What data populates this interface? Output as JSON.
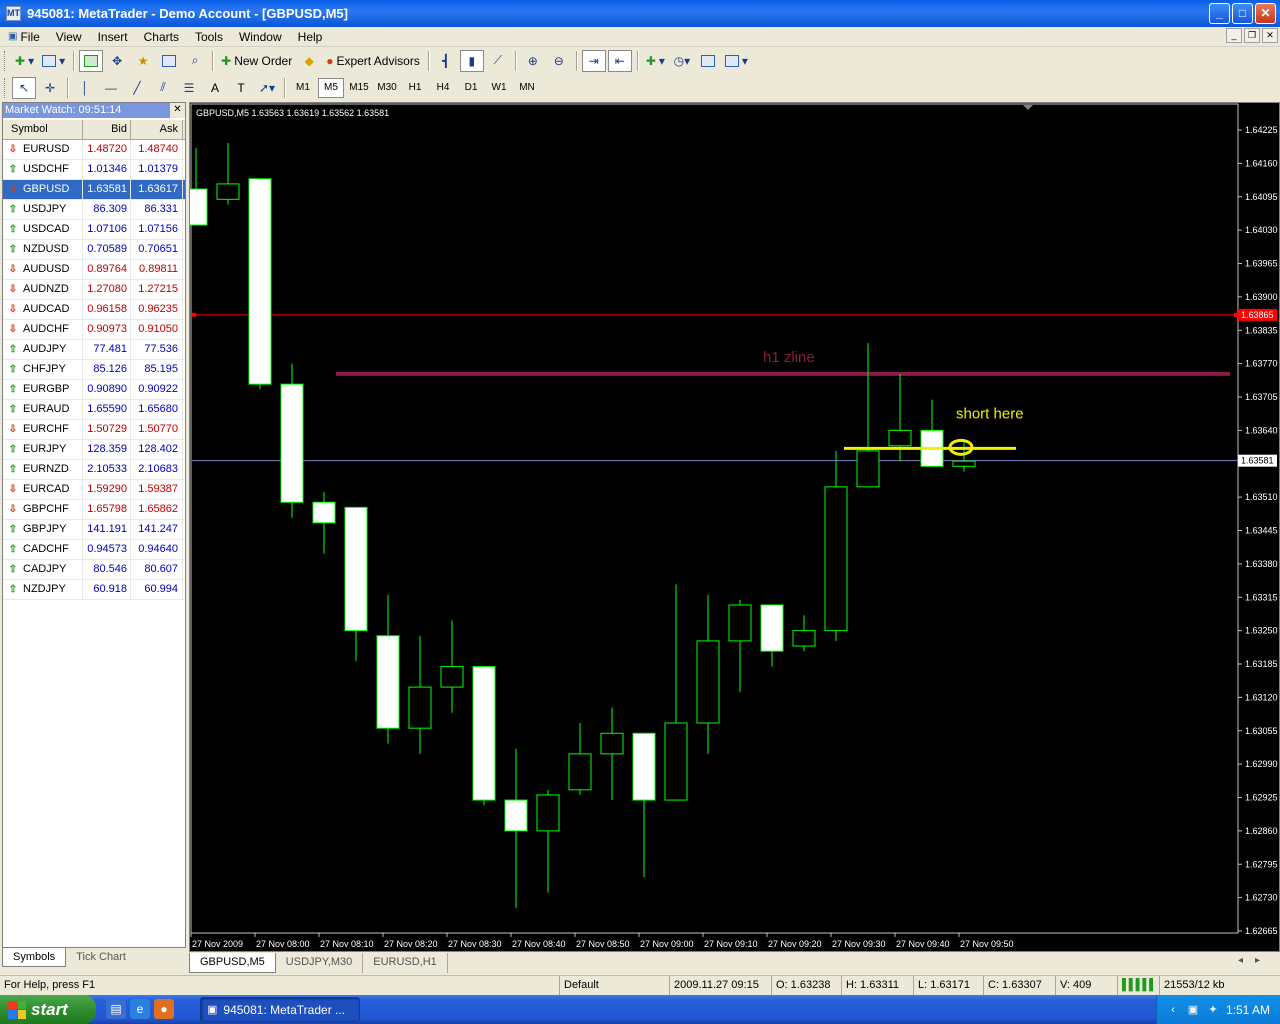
{
  "window": {
    "title": "945081: MetaTrader - Demo Account - [GBPUSD,M5]",
    "app_icon_label": "MT"
  },
  "menu": [
    "File",
    "View",
    "Insert",
    "Charts",
    "Tools",
    "Window",
    "Help"
  ],
  "toolbar": {
    "new_order": "New Order",
    "expert_advisors": "Expert Advisors",
    "draw_text": "A",
    "draw_label": "T"
  },
  "timeframes": [
    "M1",
    "M5",
    "M15",
    "M30",
    "H1",
    "H4",
    "D1",
    "W1",
    "MN"
  ],
  "active_timeframe": "M5",
  "market_watch": {
    "title": "Market Watch: 09:51:14",
    "columns": [
      "Symbol",
      "Bid",
      "Ask"
    ],
    "rows": [
      {
        "symbol": "EURUSD",
        "bid": "1.48720",
        "ask": "1.48740",
        "dir": "down",
        "color": "#c00000"
      },
      {
        "symbol": "USDCHF",
        "bid": "1.01346",
        "ask": "1.01379",
        "dir": "up",
        "color": "#0000c0"
      },
      {
        "symbol": "GBPUSD",
        "bid": "1.63581",
        "ask": "1.63617",
        "dir": "down",
        "color": "#ffffff"
      },
      {
        "symbol": "USDJPY",
        "bid": "86.309",
        "ask": "86.331",
        "dir": "up",
        "color": "#0000c0"
      },
      {
        "symbol": "USDCAD",
        "bid": "1.07106",
        "ask": "1.07156",
        "dir": "up",
        "color": "#0000c0"
      },
      {
        "symbol": "NZDUSD",
        "bid": "0.70589",
        "ask": "0.70651",
        "dir": "up",
        "color": "#0000c0"
      },
      {
        "symbol": "AUDUSD",
        "bid": "0.89764",
        "ask": "0.89811",
        "dir": "down",
        "color": "#c00000"
      },
      {
        "symbol": "AUDNZD",
        "bid": "1.27080",
        "ask": "1.27215",
        "dir": "down",
        "color": "#c00000"
      },
      {
        "symbol": "AUDCAD",
        "bid": "0.96158",
        "ask": "0.96235",
        "dir": "down",
        "color": "#c00000"
      },
      {
        "symbol": "AUDCHF",
        "bid": "0.90973",
        "ask": "0.91050",
        "dir": "down",
        "color": "#c00000"
      },
      {
        "symbol": "AUDJPY",
        "bid": "77.481",
        "ask": "77.536",
        "dir": "up",
        "color": "#0000c0"
      },
      {
        "symbol": "CHFJPY",
        "bid": "85.126",
        "ask": "85.195",
        "dir": "up",
        "color": "#0000c0"
      },
      {
        "symbol": "EURGBP",
        "bid": "0.90890",
        "ask": "0.90922",
        "dir": "up",
        "color": "#0000c0"
      },
      {
        "symbol": "EURAUD",
        "bid": "1.65590",
        "ask": "1.65680",
        "dir": "up",
        "color": "#0000c0"
      },
      {
        "symbol": "EURCHF",
        "bid": "1.50729",
        "ask": "1.50770",
        "dir": "down",
        "color": "#c00000"
      },
      {
        "symbol": "EURJPY",
        "bid": "128.359",
        "ask": "128.402",
        "dir": "up",
        "color": "#0000c0"
      },
      {
        "symbol": "EURNZD",
        "bid": "2.10533",
        "ask": "2.10683",
        "dir": "up",
        "color": "#0000c0"
      },
      {
        "symbol": "EURCAD",
        "bid": "1.59290",
        "ask": "1.59387",
        "dir": "down",
        "color": "#c00000"
      },
      {
        "symbol": "GBPCHF",
        "bid": "1.65798",
        "ask": "1.65862",
        "dir": "down",
        "color": "#c00000"
      },
      {
        "symbol": "GBPJPY",
        "bid": "141.191",
        "ask": "141.247",
        "dir": "up",
        "color": "#0000c0"
      },
      {
        "symbol": "CADCHF",
        "bid": "0.94573",
        "ask": "0.94640",
        "dir": "up",
        "color": "#0000c0"
      },
      {
        "symbol": "CADJPY",
        "bid": "80.546",
        "ask": "80.607",
        "dir": "up",
        "color": "#0000c0"
      },
      {
        "symbol": "NZDJPY",
        "bid": "60.918",
        "ask": "60.994",
        "dir": "up",
        "color": "#0000c0"
      }
    ],
    "tabs": [
      "Symbols",
      "Tick Chart"
    ]
  },
  "chart": {
    "info": "GBPUSD,M5  1.63563 1.63619 1.63562 1.63581",
    "price_labels": [
      "1.64225",
      "1.64160",
      "1.64095",
      "1.64030",
      "1.63965",
      "1.63900",
      "1.63835",
      "1.63770",
      "1.63705",
      "1.63640",
      "1.63510",
      "1.63445",
      "1.63380",
      "1.63315",
      "1.63250",
      "1.63185",
      "1.63120",
      "1.63055",
      "1.62990",
      "1.62925",
      "1.62860",
      "1.62795",
      "1.62730",
      "1.62665"
    ],
    "time_labels": [
      "27 Nov 2009",
      "27 Nov 08:00",
      "27 Nov 08:10",
      "27 Nov 08:20",
      "27 Nov 08:30",
      "27 Nov 08:40",
      "27 Nov 08:50",
      "27 Nov 09:00",
      "27 Nov 09:10",
      "27 Nov 09:20",
      "27 Nov 09:30",
      "27 Nov 09:40",
      "27 Nov 09:50"
    ],
    "current_price_label": "1.63581",
    "red_line_label": "1.63865",
    "annotation_zline": "h1 zline",
    "annotation_short": "short here",
    "colors": {
      "bg": "#000000",
      "bull": "#00ff00",
      "bear_body": "#ffffff",
      "zline": "#8b1c4a",
      "yellow": "#f0f000",
      "red": "#ff0000",
      "bid": "#8080c0"
    }
  },
  "chart_data": {
    "type": "candlestick",
    "title": "GBPUSD,M5",
    "ylim": [
      1.6263,
      1.6426
    ],
    "series": [
      {
        "name": "GBPUSD",
        "ohlc": [
          [
            1.6411,
            1.6419,
            1.6404,
            1.6404
          ],
          [
            1.6409,
            1.642,
            1.6408,
            1.6412
          ],
          [
            1.6413,
            1.6413,
            1.6372,
            1.6373
          ],
          [
            1.6373,
            1.6377,
            1.6347,
            1.635
          ],
          [
            1.635,
            1.6352,
            1.634,
            1.6346
          ],
          [
            1.6349,
            1.6349,
            1.6319,
            1.6325
          ],
          [
            1.6324,
            1.6332,
            1.6303,
            1.6306
          ],
          [
            1.6306,
            1.6324,
            1.6301,
            1.6314
          ],
          [
            1.6314,
            1.6327,
            1.6309,
            1.6318
          ],
          [
            1.6318,
            1.6318,
            1.6291,
            1.6292
          ],
          [
            1.6292,
            1.6302,
            1.6271,
            1.6286
          ],
          [
            1.6286,
            1.6294,
            1.6274,
            1.6293
          ],
          [
            1.6294,
            1.6307,
            1.6293,
            1.6301
          ],
          [
            1.6301,
            1.631,
            1.6292,
            1.6305
          ],
          [
            1.6305,
            1.6305,
            1.6277,
            1.6292
          ],
          [
            1.6292,
            1.6334,
            1.6292,
            1.6307
          ],
          [
            1.6307,
            1.6332,
            1.6301,
            1.6323
          ],
          [
            1.6323,
            1.6331,
            1.6313,
            1.633
          ],
          [
            1.633,
            1.633,
            1.6318,
            1.6321
          ],
          [
            1.6322,
            1.6328,
            1.6321,
            1.6325
          ],
          [
            1.6325,
            1.636,
            1.6323,
            1.6353
          ],
          [
            1.6353,
            1.6381,
            1.6353,
            1.636
          ],
          [
            1.6361,
            1.6375,
            1.6358,
            1.6364
          ],
          [
            1.6364,
            1.637,
            1.6357,
            1.6357
          ],
          [
            1.6357,
            1.6362,
            1.6356,
            1.6358
          ]
        ]
      }
    ],
    "hlines": [
      {
        "label": "h1 zline",
        "value": 1.6375
      },
      {
        "label": "red",
        "value": 1.63865
      },
      {
        "label": "bid",
        "value": 1.63581
      },
      {
        "label": "short here",
        "value": 1.63605
      }
    ]
  },
  "chart_tabs": [
    "GBPUSD,M5",
    "USDJPY,M30",
    "EURUSD,H1"
  ],
  "status": {
    "help": "For Help, press F1",
    "profile": "Default",
    "datetime": "2009.11.27 09:15",
    "open": "O: 1.63238",
    "high": "H: 1.63311",
    "low": "L: 1.63171",
    "close": "C: 1.63307",
    "volume": "V: 409",
    "traffic": "21553/12 kb"
  },
  "taskbar": {
    "start": "start",
    "task": "945081: MetaTrader ...",
    "clock": "1:51 AM"
  }
}
